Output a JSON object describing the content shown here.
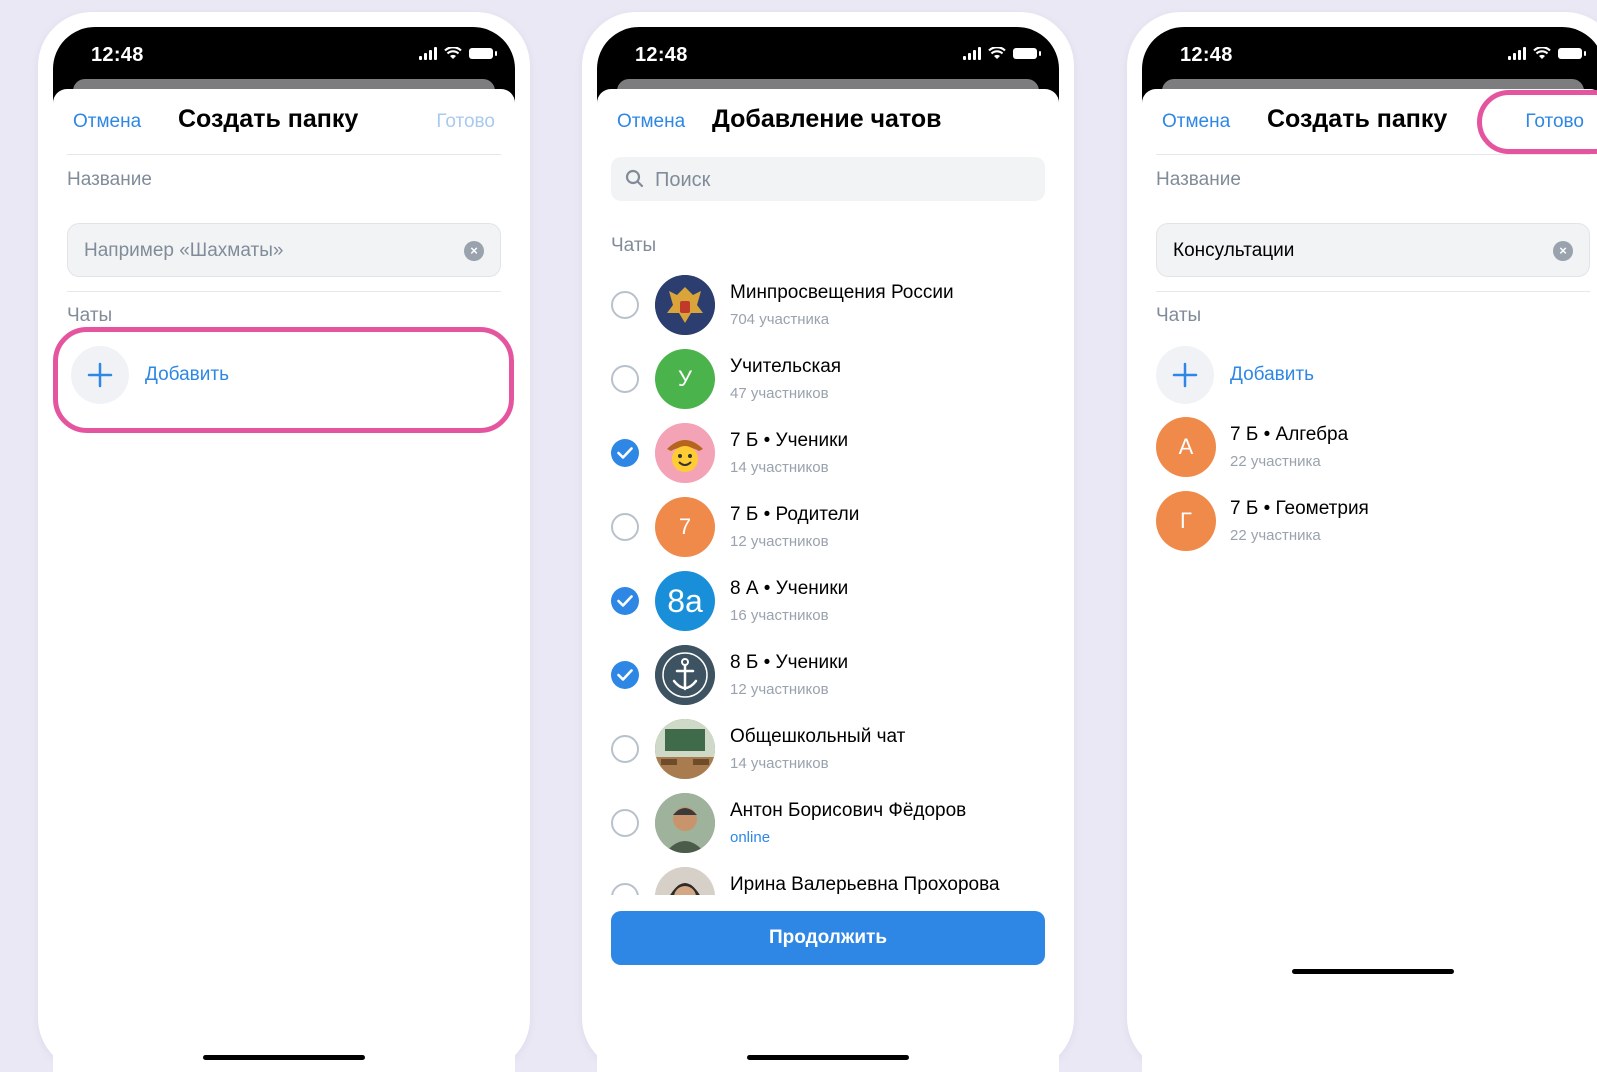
{
  "status": {
    "time": "12:48"
  },
  "screen1": {
    "cancel": "Отмена",
    "title": "Создать папку",
    "done": "Готово",
    "name_label": "Название",
    "name_placeholder": "Например «Шахматы»",
    "name_value": "",
    "chats_label": "Чаты",
    "add_label": "Добавить"
  },
  "screen2": {
    "cancel": "Отмена",
    "title": "Добавление чатов",
    "search_placeholder": "Поиск",
    "chats_label": "Чаты",
    "continue": "Продолжить",
    "chats": [
      {
        "name": "Минпросвещения России",
        "sub": "704 участника",
        "checked": false,
        "avatar": "emblem",
        "avatar_color": "#2c3e70"
      },
      {
        "name": "Учительская",
        "sub": "47 участников",
        "checked": false,
        "avatar": "У",
        "avatar_color": "#4bb34b"
      },
      {
        "name": " 7 Б • Ученики",
        "sub": "14 участников",
        "checked": true,
        "avatar": "emoji",
        "avatar_color": "#f4a3b7"
      },
      {
        "name": "7 Б • Родители",
        "sub": "12 участников",
        "checked": false,
        "avatar": "7",
        "avatar_color": "#f08a4b"
      },
      {
        "name": "8 А • Ученики",
        "sub": "16 участников",
        "checked": true,
        "avatar": "8a",
        "avatar_color": "#1a8fd9"
      },
      {
        "name": "8 Б • Ученики",
        "sub": "12 участников",
        "checked": true,
        "avatar": "anchor",
        "avatar_color": "#3d5361"
      },
      {
        "name": "Общешкольный чат",
        "sub": "14 участников",
        "checked": false,
        "avatar": "photo",
        "avatar_color": "#7a8a5a"
      },
      {
        "name": "Антон Борисович Фёдоров",
        "sub": "online",
        "checked": false,
        "avatar": "person",
        "avatar_color": "#6b7a6a"
      },
      {
        "name": "Ирина Валерьевна Прохорова",
        "sub": "",
        "checked": false,
        "avatar": "person",
        "avatar_color": "#4a4440"
      }
    ]
  },
  "screen3": {
    "cancel": "Отмена",
    "title": "Создать папку",
    "done": "Готово",
    "name_label": "Название",
    "name_value": "Консультации",
    "chats_label": "Чаты",
    "add_label": "Добавить",
    "chats": [
      {
        "name": " 7 Б • Алгебра",
        "sub": "22 участника",
        "avatar": "А",
        "avatar_color": "#f08a4b"
      },
      {
        "name": " 7 Б • Геометрия",
        "sub": "22 участника",
        "avatar": "Г",
        "avatar_color": "#f08a4b"
      }
    ]
  },
  "colors": {
    "accent": "#2e87e5",
    "highlight": "#e5559f",
    "background": "#ebe8f5"
  }
}
